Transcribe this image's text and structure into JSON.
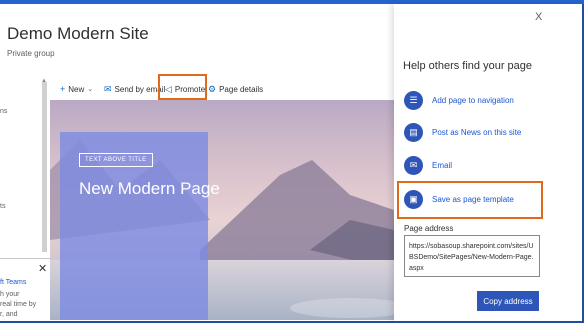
{
  "site": {
    "title": "Demo Modern Site",
    "subtitle": "Private group"
  },
  "left_fragments": {
    "top": "ns",
    "mid": "ts",
    "teams_title": "ft Teams",
    "teams_line1": "h your",
    "teams_line2": "real time by",
    "teams_line3": "r, and"
  },
  "commandbar": {
    "new": "New",
    "send_by_email": "Send by email",
    "promote": "Promote",
    "page_details": "Page details"
  },
  "hero": {
    "above_title": "TEXT ABOVE TITLE",
    "page_title": "New Modern Page"
  },
  "panel": {
    "close": "X",
    "heading": "Help others find your page",
    "options": [
      {
        "label": "Add page to navigation",
        "icon": "list-icon"
      },
      {
        "label": "Post as News on this site",
        "icon": "news-icon"
      },
      {
        "label": "Email",
        "icon": "email-icon"
      },
      {
        "label": "Save as page template",
        "icon": "save-icon"
      }
    ],
    "address_label": "Page address",
    "address_value": "https://sobasoup.sharepoint.com/sites/UBSDemo/SitePages/New-Modern-Page.aspx",
    "copy_button": "Copy address"
  },
  "colors": {
    "accent": "#2e55b8",
    "highlight": "#e06a1b",
    "link": "#1b56d6",
    "hero_panel": "#7e8be2"
  }
}
